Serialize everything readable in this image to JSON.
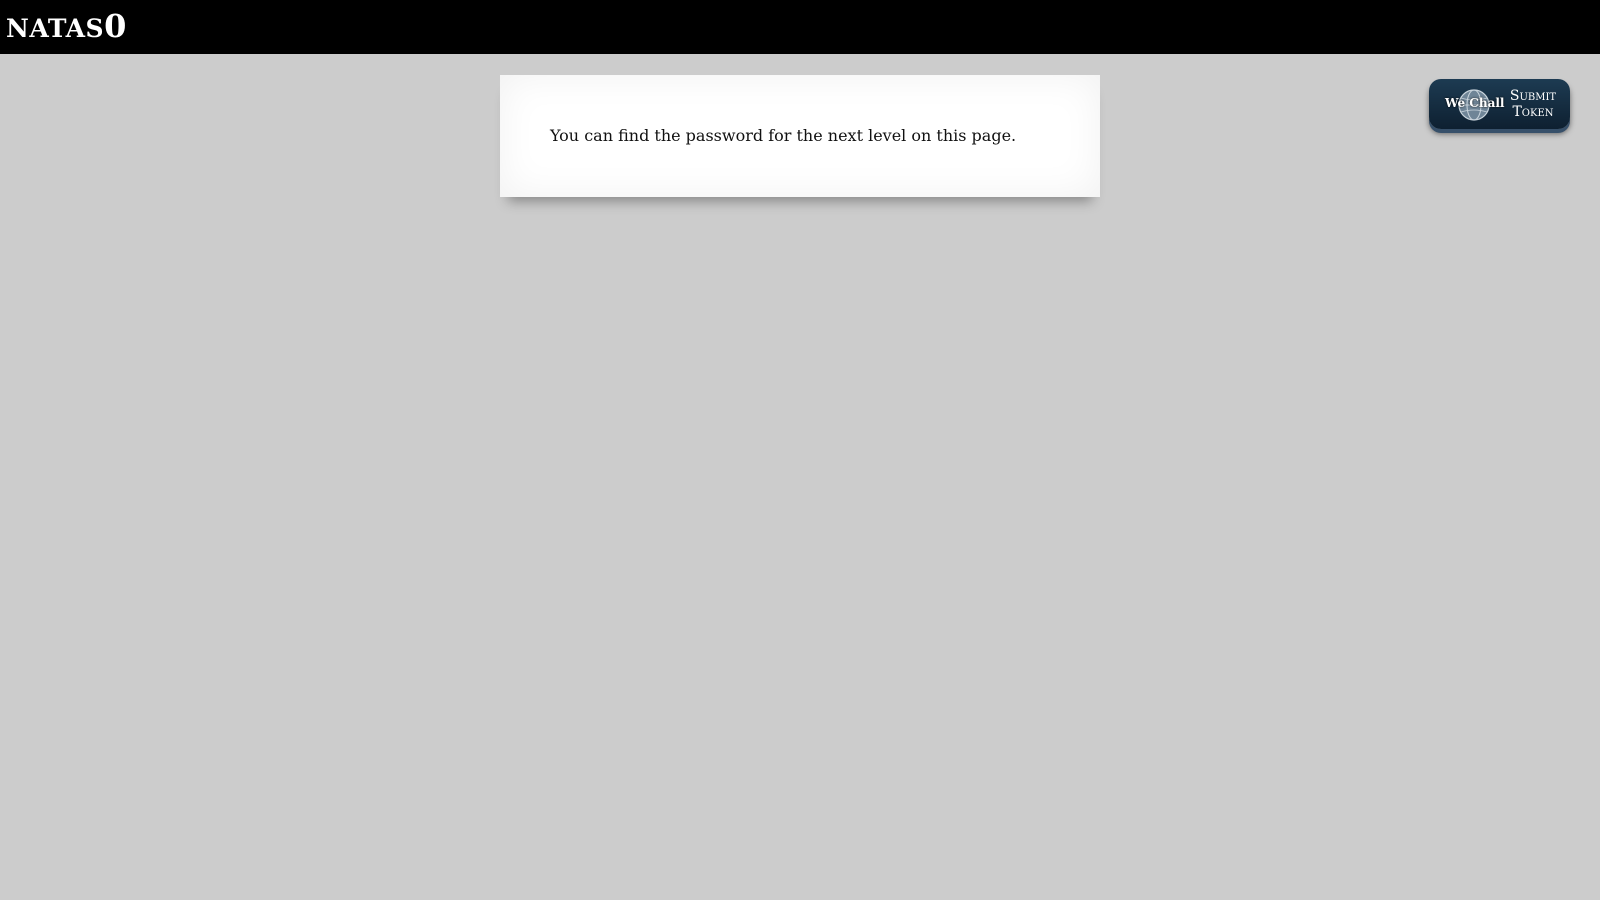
{
  "header": {
    "title_name": "NATAS",
    "title_level": "0"
  },
  "content": {
    "message": "You can find the password for the next level on this page."
  },
  "wechall": {
    "logo_text": "We Chall",
    "submit_line1": "Submit",
    "submit_line2": "Token",
    "logo_icon": "globe-icon"
  },
  "colors": {
    "header_bg": "#000000",
    "page_bg": "#cccccc",
    "card_bg": "#ffffff",
    "button_bg": "#1d3b52"
  }
}
